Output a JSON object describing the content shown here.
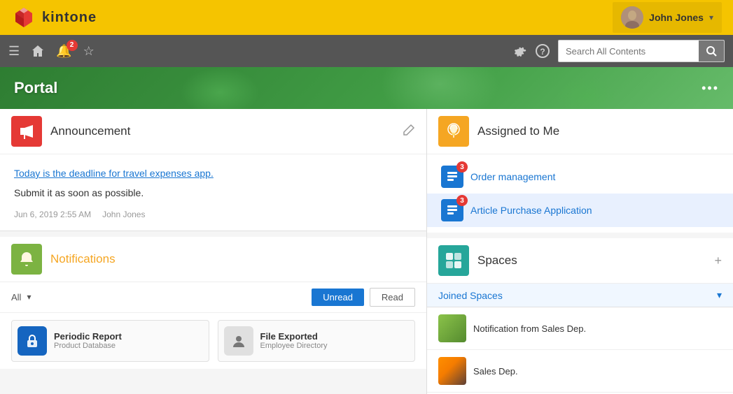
{
  "header": {
    "logo_text": "kintone",
    "user_name": "John Jones",
    "chevron": "▾"
  },
  "navbar": {
    "notification_badge": "2",
    "search_placeholder": "Search All Contents"
  },
  "portal": {
    "title": "Portal",
    "more_button": "•••"
  },
  "announcement": {
    "title": "Announcement",
    "link_text": "Today is the deadline for travel expenses app.",
    "body_text": "Submit it as soon as possible.",
    "meta_date": "Jun 6, 2019 2:55 AM",
    "meta_user": "John Jones"
  },
  "notifications": {
    "title": "Notifications",
    "filter_all": "All",
    "btn_unread": "Unread",
    "btn_read": "Read",
    "items": [
      {
        "title": "Periodic Report",
        "sub": "Product Database",
        "icon_type": "lock"
      },
      {
        "title": "File Exported",
        "sub": "Employee Directory",
        "icon_type": "user"
      }
    ]
  },
  "assigned_to_me": {
    "title": "Assigned to Me",
    "items": [
      {
        "name": "Order management",
        "badge": "3"
      },
      {
        "name": "Article Purchase Application",
        "badge": "3"
      }
    ]
  },
  "spaces": {
    "title": "Spaces",
    "joined_label": "Joined Spaces",
    "items": [
      {
        "name": "Notification from Sales Dep.",
        "thumb_type": "sales"
      },
      {
        "name": "Sales Dep.",
        "thumb_type": "pencils"
      }
    ]
  }
}
